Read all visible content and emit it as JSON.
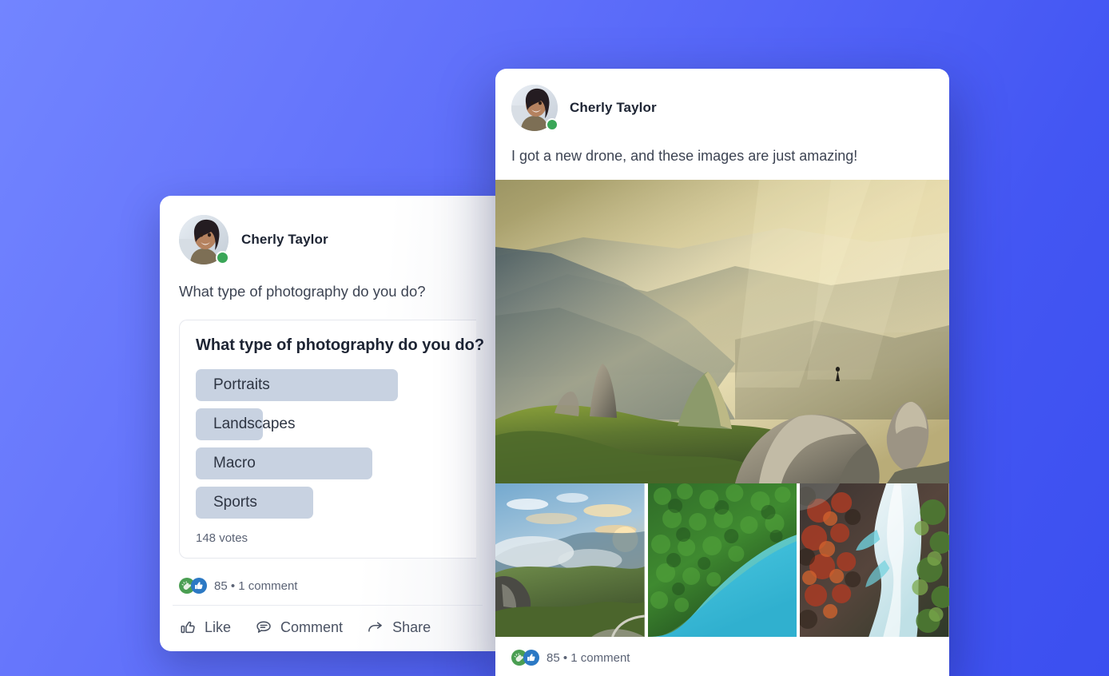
{
  "theme": {
    "background_start": "#7285FF",
    "background_end": "#3B4FF0",
    "poll_bar_color": "#C8D2E1",
    "status_dot_color": "#3AA658",
    "reaction_green": "#4A9E52",
    "reaction_blue": "#2C79C4"
  },
  "poll_card": {
    "author": {
      "name": "Cherly Taylor",
      "avatar": "user-avatar-photo",
      "status": "online"
    },
    "post_text": "What type of photography do you do?",
    "poll": {
      "question": "What type of photography do you do?",
      "options": [
        {
          "label": "Portraits",
          "bar_width_pct": 72
        },
        {
          "label": "Landscapes",
          "bar_width_pct": 24
        },
        {
          "label": "Macro",
          "bar_width_pct": 63
        },
        {
          "label": "Sports",
          "bar_width_pct": 42
        }
      ],
      "votes_text": "148 votes"
    },
    "engagement": {
      "reactions": [
        "celebrate-reaction-icon",
        "like-reaction-icon"
      ],
      "summary": "85 • 1 comment"
    },
    "actions": [
      {
        "label": "Like",
        "icon": "thumbs-up-icon"
      },
      {
        "label": "Comment",
        "icon": "speech-bubble-icon"
      },
      {
        "label": "Share",
        "icon": "share-arrow-icon"
      }
    ]
  },
  "post_card": {
    "author": {
      "name": "Cherly Taylor",
      "avatar": "user-avatar-photo",
      "status": "online"
    },
    "post_text": "I got a new drone, and these images are just amazing!",
    "media": {
      "hero": "mountain-valley-golden-hour-photo",
      "thumbnails": [
        "sunset-valley-cliffs-photo",
        "aerial-forest-turquoise-lake-photo",
        "autumn-forest-river-aerial-photo"
      ]
    },
    "engagement": {
      "reactions": [
        "celebrate-reaction-icon",
        "like-reaction-icon"
      ],
      "summary": "85 • 1 comment"
    }
  }
}
